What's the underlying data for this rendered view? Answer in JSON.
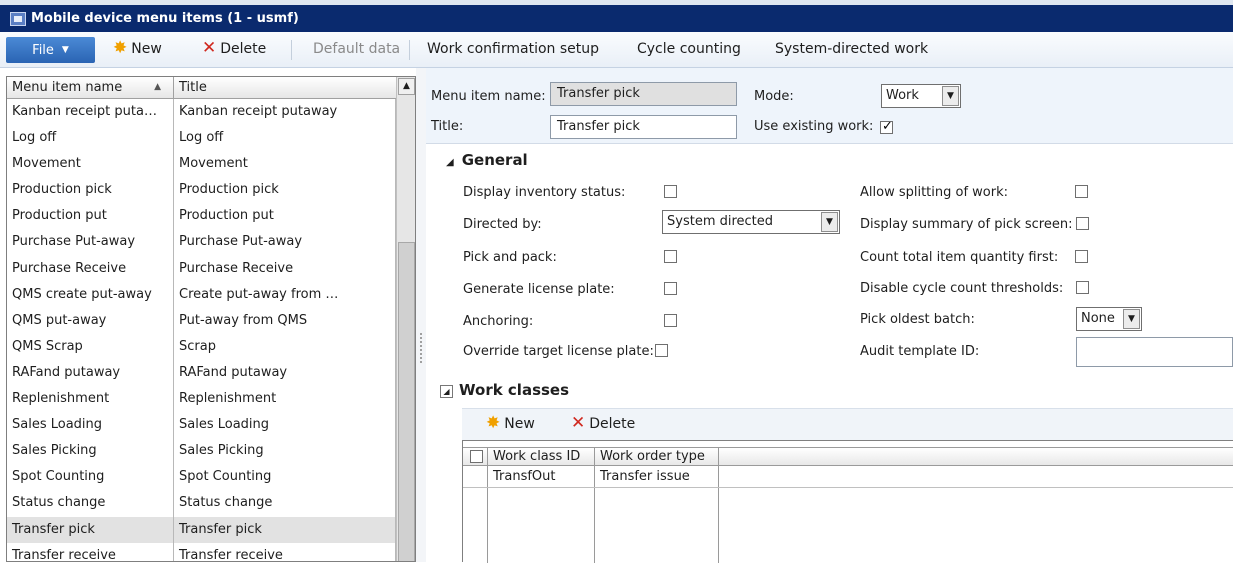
{
  "window": {
    "title": "Mobile device menu items (1 - usmf)"
  },
  "toolbar": {
    "file_label": "File",
    "new_label": "New",
    "delete_label": "Delete",
    "default_data_label": "Default data",
    "work_confirmation_label": "Work confirmation setup",
    "cycle_counting_label": "Cycle counting",
    "system_directed_label": "System-directed work"
  },
  "list": {
    "columns": [
      "Menu item name",
      "Title"
    ],
    "rows": [
      [
        "Kanban receipt puta…",
        "Kanban receipt putaway"
      ],
      [
        "Log off",
        "Log off"
      ],
      [
        "Movement",
        "Movement"
      ],
      [
        "Production pick",
        "Production pick"
      ],
      [
        "Production put",
        "Production put"
      ],
      [
        "Purchase Put-away",
        "Purchase Put-away"
      ],
      [
        "Purchase Receive",
        "Purchase Receive"
      ],
      [
        "QMS create put-away",
        "Create put-away from …"
      ],
      [
        "QMS put-away",
        "Put-away from QMS"
      ],
      [
        "QMS Scrap",
        "Scrap"
      ],
      [
        "RAFand putaway",
        "RAFand putaway"
      ],
      [
        "Replenishment",
        "Replenishment"
      ],
      [
        "Sales Loading",
        "Sales Loading"
      ],
      [
        "Sales Picking",
        "Sales Picking"
      ],
      [
        "Spot Counting",
        "Spot Counting"
      ],
      [
        "Status change",
        "Status change"
      ],
      [
        "Transfer pick",
        "Transfer pick"
      ],
      [
        "Transfer receive",
        "Transfer receive"
      ]
    ],
    "selected_row": "Transfer pick"
  },
  "header": {
    "menu_item_name_label": "Menu item name:",
    "menu_item_name_value": "Transfer pick",
    "title_label": "Title:",
    "title_value": "Transfer pick",
    "mode_label": "Mode:",
    "mode_value": "Work",
    "use_existing_work_label": "Use existing work:",
    "use_existing_work_checked": true
  },
  "general": {
    "section_title": "General",
    "display_inventory_status_label": "Display inventory status:",
    "directed_by_label": "Directed by:",
    "directed_by_value": "System directed",
    "pick_and_pack_label": "Pick and pack:",
    "generate_license_plate_label": "Generate license plate:",
    "anchoring_label": "Anchoring:",
    "override_target_label": "Override target license plate:",
    "allow_splitting_label": "Allow splitting of work:",
    "display_summary_label": "Display summary of pick screen:",
    "count_total_label": "Count total item quantity first:",
    "disable_cycle_label": "Disable cycle count thresholds:",
    "pick_oldest_batch_label": "Pick oldest batch:",
    "pick_oldest_batch_value": "None",
    "audit_template_label": "Audit template ID:",
    "audit_template_value": ""
  },
  "work_classes": {
    "section_title": "Work classes",
    "new_label": "New",
    "delete_label": "Delete",
    "columns": [
      "Work class ID",
      "Work order type"
    ],
    "rows": [
      [
        "TransfOut",
        "Transfer issue"
      ]
    ]
  },
  "colors": {
    "title_bar": "#0a2a6e",
    "file_button": "#2a64b3",
    "selected_row": "#e2e2e2"
  }
}
